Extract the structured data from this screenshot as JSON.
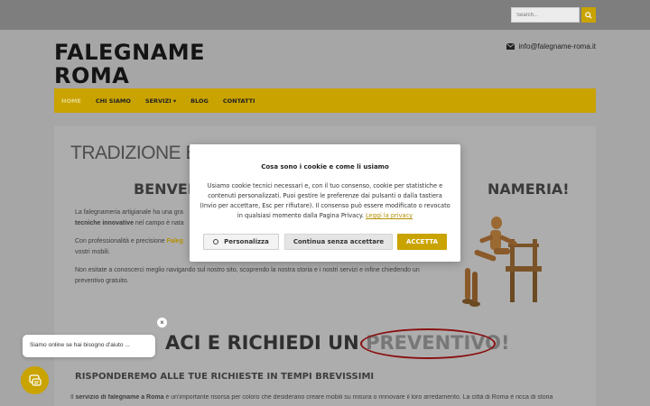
{
  "topbar": {
    "search_placeholder": "Search..."
  },
  "header": {
    "logo_line1": "FALEGNAME",
    "logo_line2": "ROMA",
    "email": "info@falegname-roma.it"
  },
  "nav": {
    "items": [
      "HOME",
      "CHI SIAMO",
      "SERVIZI ▾",
      "BLOG",
      "CONTATTI"
    ]
  },
  "content": {
    "heading_trad": "TRADIZIONE E IN",
    "heading_benv_left": "BENVEN",
    "heading_benv_right": "NAMERIA!",
    "para1_a": "La falegnameria artigianale ha una gra",
    "para1_b": "tecniche innovative",
    "para1_c": " nel campo è nata",
    "para2_a": "Con professionalità e precisione ",
    "para2_b": "Faleg",
    "para2_c": "vostri mobili.",
    "para3": "Non esitate a conoscerci meglio navigando sul nostro sito, scoprendo la nostra storia e i nostri servizi e infine chiedendo un preventivo gratuito.",
    "heading_prev_a": "ACI E RICHIEDI UN ",
    "heading_prev_b": "PREVENTIVO!",
    "heading_risp": "RISPONDEREMO ALLE TUE RICHIESTE IN TEMPI BREVISSIMI",
    "para_bottom_a": "Il ",
    "para_bottom_b": "servizio di falegname a Roma",
    "para_bottom_c": " è un'importante risorsa per coloro che desiderano creare mobili su misura o rinnovare il loro arredamento. La città di Roma è ricca di storia"
  },
  "cookie": {
    "title": "Cosa sono i cookie e come li usiamo",
    "body": "Usiamo cookie tecnici necessari e, con il tuo consenso, cookie per statistiche e contenuti personalizzati. Puoi gestire le preferenze dai pulsanti o dalla tastiera (Invio per accettare, Esc per rifiutare). Il consenso può essere modificato o revocato in qualsiasi momento dalla Pagina Privacy. ",
    "link": "Leggi la privacy",
    "btn_personalize": "Personalizza",
    "btn_continue": "Continua senza accettare",
    "btn_accept": "ACCETTA"
  },
  "chat": {
    "message": "Siamo online se hai bisogno d'aiuto ...",
    "close": "×"
  },
  "colors": {
    "accent": "#c9a300",
    "overlay": "#a6a6a6",
    "dark": "#141414"
  }
}
